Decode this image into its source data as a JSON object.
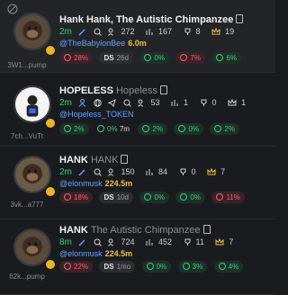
{
  "tokens": [
    {
      "name": "Hank Hank, The Autistic Chimpanzee",
      "symbol": "",
      "age": "2m",
      "holders": "272",
      "views": "167",
      "cup": "8",
      "crown": "19",
      "handle": "@TheBabylonBee",
      "followers": "6.0m",
      "ca": "3W1...pump",
      "badges": {
        "top10": "28%",
        "ds": "DS",
        "ds_age": "26d",
        "green1": "0%",
        "red2": "7%",
        "green3": "6%"
      }
    },
    {
      "name": "HOPELESS",
      "symbol": "Hopeless",
      "age": "2m",
      "holders": "53",
      "views": "1",
      "cup": "0",
      "crown": "1",
      "handle": "@Hopeless_TOKEN",
      "followers": "",
      "ca": "7ch...VuTt",
      "badges": {
        "top10": "2%",
        "sniper": "0%",
        "sniper_age": "7m",
        "green1": "2%",
        "green2": "0%",
        "green3": "2%"
      }
    },
    {
      "name": "HANK",
      "symbol": "HANK",
      "age": "2m",
      "holders": "150",
      "views": "84",
      "cup": "0",
      "crown": "7",
      "handle": "@elonmusk",
      "followers": "224.5m",
      "ca": "3vk...a777",
      "badges": {
        "top10": "18%",
        "ds": "DS",
        "ds_age": "10d",
        "green1": "0%",
        "green2": "0%",
        "red3": "11%"
      }
    },
    {
      "name": "HANK",
      "symbol": "The Autistic Chimpanzee",
      "age": "8m",
      "holders": "724",
      "views": "452",
      "cup": "11",
      "crown": "7",
      "handle": "@elonmusk",
      "followers": "224.5m",
      "ca": "62k...pump",
      "badges": {
        "top10": "22%",
        "ds": "DS",
        "ds_age": "1mo",
        "green1": "0%",
        "green2": "3%",
        "green3": "4%"
      }
    }
  ],
  "colors": {
    "green": "#2fd17b",
    "red": "#ff5c6c",
    "blue": "#5ea2ff",
    "gold": "#f2c23c"
  }
}
